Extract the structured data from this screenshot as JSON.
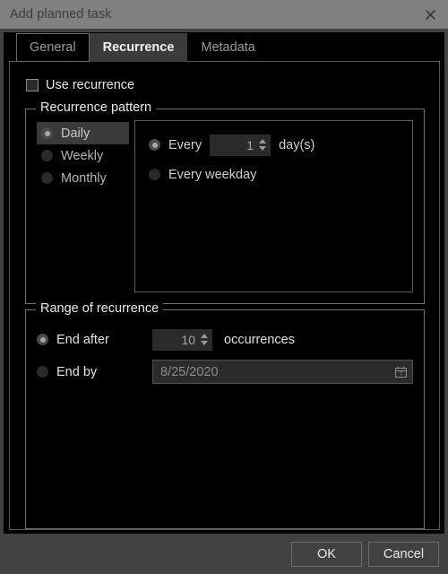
{
  "window": {
    "title": "Add planned task",
    "close_icon": "close-icon"
  },
  "tabs": [
    {
      "label": "General",
      "state": "focused"
    },
    {
      "label": "Recurrence",
      "state": "active"
    },
    {
      "label": "Metadata",
      "state": "normal"
    }
  ],
  "use_recurrence": {
    "label": "Use recurrence",
    "checked": false
  },
  "recurrence_pattern": {
    "title": "Recurrence pattern",
    "frequency_options": [
      {
        "label": "Daily",
        "selected": true
      },
      {
        "label": "Weekly",
        "selected": false
      },
      {
        "label": "Monthly",
        "selected": false
      }
    ],
    "daily": {
      "every_radio_label": "Every",
      "every_selected": true,
      "interval_value": "1",
      "interval_unit_label": "day(s)",
      "weekday_radio_label": "Every weekday",
      "weekday_selected": false
    }
  },
  "range_of_recurrence": {
    "title": "Range of recurrence",
    "end_after": {
      "label": "End after",
      "selected": true,
      "value": "10",
      "unit_label": "occurrences"
    },
    "end_by": {
      "label": "End by",
      "selected": false,
      "date_value": "8/25/2020",
      "calendar_icon": "calendar-icon"
    }
  },
  "footer": {
    "ok_label": "OK",
    "cancel_label": "Cancel"
  },
  "colors": {
    "titlebar": "#808080",
    "dialog_chrome": "#414141",
    "content": "#000000",
    "active_tab": "#3b3b3b",
    "selection": "#3a3a3a",
    "border": "#6e6e6e",
    "text": "#e8e8e8",
    "muted_text": "#8b8b8b"
  }
}
